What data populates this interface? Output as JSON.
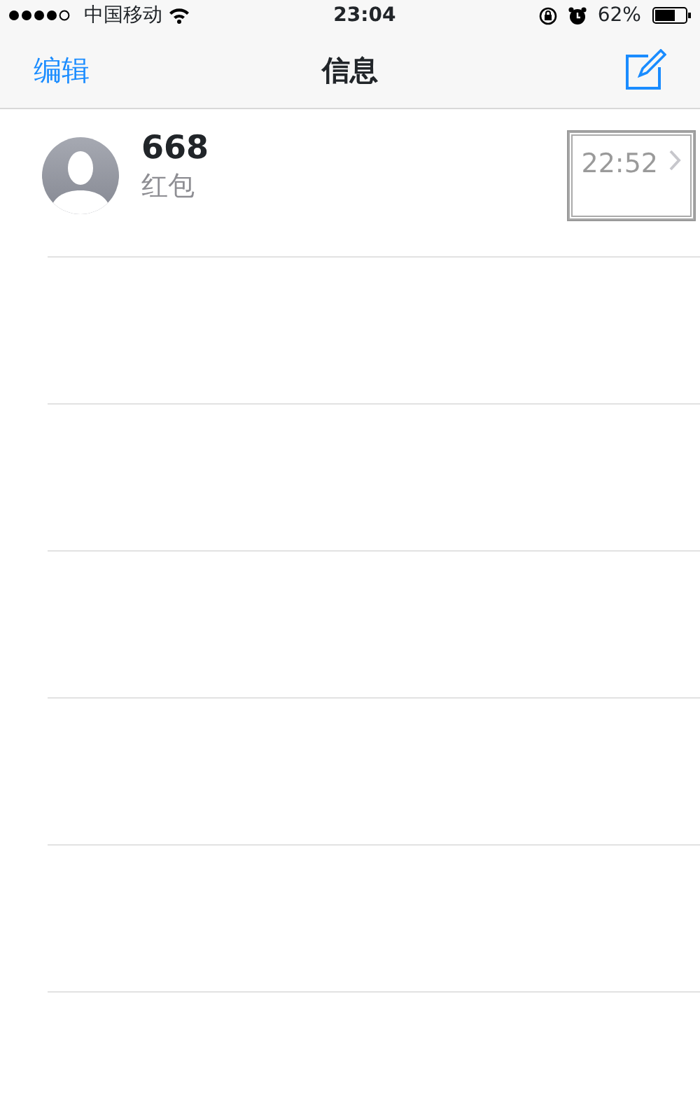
{
  "status_bar": {
    "carrier": "中国移动",
    "time": "23:04",
    "battery": "62%"
  },
  "nav_bar": {
    "edit": "编辑",
    "title": "信息"
  },
  "conversations": [
    {
      "name": "668",
      "preview": "红包",
      "time": "22:52",
      "highlighted": true
    }
  ]
}
